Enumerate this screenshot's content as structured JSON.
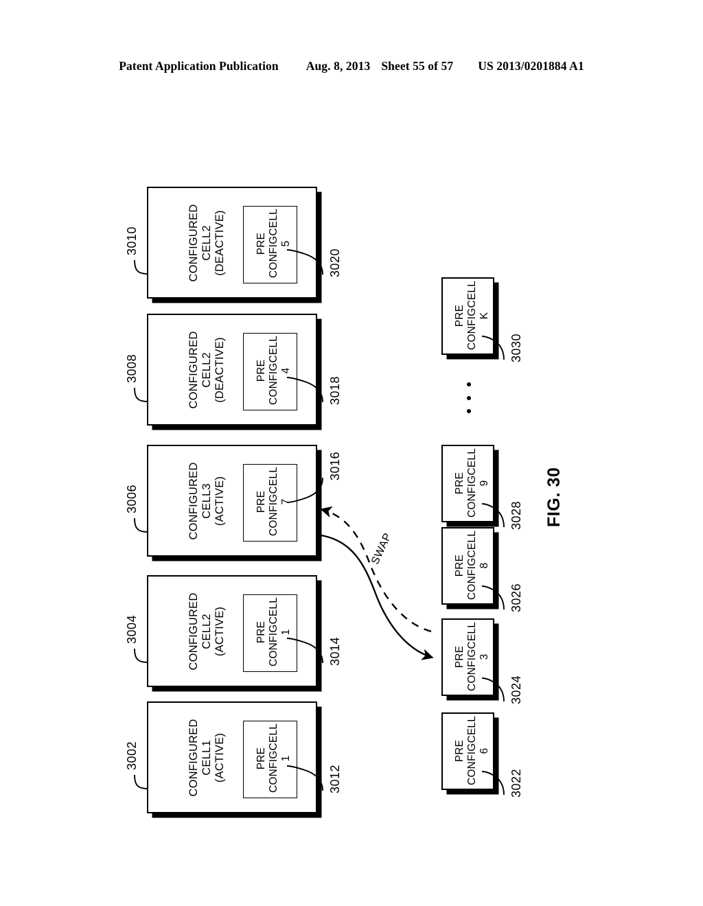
{
  "header": {
    "publication": "Patent Application Publication",
    "date": "Aug. 8, 2013",
    "sheet": "Sheet 55 of 57",
    "patent_number": "US 2013/0201884 A1"
  },
  "figure": {
    "label": "FIG. 30",
    "swap_label": "SWAP",
    "ellipsis": "•"
  },
  "configured_cells": [
    {
      "ref": "3010",
      "line1": "CONFIGURED",
      "line2": "CELL2",
      "line3": "(DEACTIVE)",
      "inner": {
        "ref": "3020",
        "line1": "PRE",
        "line2": "CONFIGCELL",
        "line3": "5"
      }
    },
    {
      "ref": "3008",
      "line1": "CONFIGURED",
      "line2": "CELL2",
      "line3": "(DEACTIVE)",
      "inner": {
        "ref": "3018",
        "line1": "PRE",
        "line2": "CONFIGCELL",
        "line3": "4"
      }
    },
    {
      "ref": "3006",
      "line1": "CONFIGURED",
      "line2": "CELL3",
      "line3": "(ACTIVE)",
      "inner": {
        "ref": "3016",
        "line1": "PRE",
        "line2": "CONFIGCELL",
        "line3": "7"
      }
    },
    {
      "ref": "3004",
      "line1": "CONFIGURED",
      "line2": "CELL2",
      "line3": "(ACTIVE)",
      "inner": {
        "ref": "3014",
        "line1": "PRE",
        "line2": "CONFIGCELL",
        "line3": "1"
      }
    },
    {
      "ref": "3002",
      "line1": "CONFIGURED",
      "line2": "CELL1",
      "line3": "(ACTIVE)",
      "inner": {
        "ref": "3012",
        "line1": "PRE",
        "line2": "CONFIGCELL",
        "line3": "1"
      }
    }
  ],
  "preconfig_cells": [
    {
      "ref": "3030",
      "line1": "PRE",
      "line2": "CONFIGCELL",
      "line3": "K"
    },
    {
      "ref": "3028",
      "line1": "PRE",
      "line2": "CONFIGCELL",
      "line3": "9"
    },
    {
      "ref": "3026",
      "line1": "PRE",
      "line2": "CONFIGCELL",
      "line3": "8"
    },
    {
      "ref": "3024",
      "line1": "PRE",
      "line2": "CONFIGCELL",
      "line3": "3"
    },
    {
      "ref": "3022",
      "line1": "PRE",
      "line2": "CONFIGCELL",
      "line3": "6"
    }
  ],
  "colors": {
    "ink": "#000000",
    "paper": "#ffffff"
  }
}
